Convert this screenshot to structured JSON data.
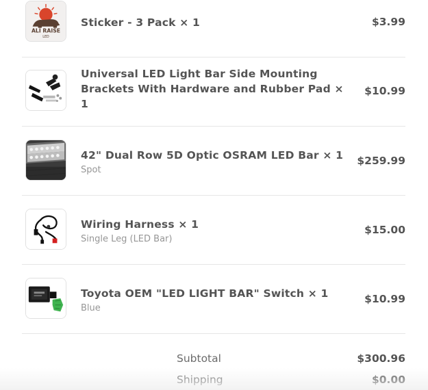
{
  "items": [
    {
      "title": "Sticker - 3 Pack × 1",
      "variant": "",
      "price": "$3.99",
      "thumb_icon": "bear-logo-sticker-icon",
      "thumb_text": "ALI RAISE",
      "thumb_subtext": "LED"
    },
    {
      "title": "Universal LED Light Bar Side Mounting Brackets With Hardware and Rubber Pad × 1",
      "variant": "",
      "price": "$10.99",
      "thumb_icon": "mounting-brackets-icon"
    },
    {
      "title": "42\" Dual Row 5D Optic OSRAM LED Bar × 1",
      "variant": "Spot",
      "price": "$259.99",
      "thumb_icon": "led-bar-icon"
    },
    {
      "title": "Wiring Harness × 1",
      "variant": "Single Leg (LED Bar)",
      "price": "$15.00",
      "thumb_icon": "wiring-harness-icon"
    },
    {
      "title": "Toyota OEM \"LED LIGHT BAR\" Switch × 1",
      "variant": "Blue",
      "price": "$10.99",
      "thumb_icon": "switch-icon"
    }
  ],
  "summary": {
    "subtotal_label": "Subtotal",
    "subtotal_value": "$300.96",
    "shipping_label": "Shipping",
    "shipping_value": "$0.00"
  }
}
